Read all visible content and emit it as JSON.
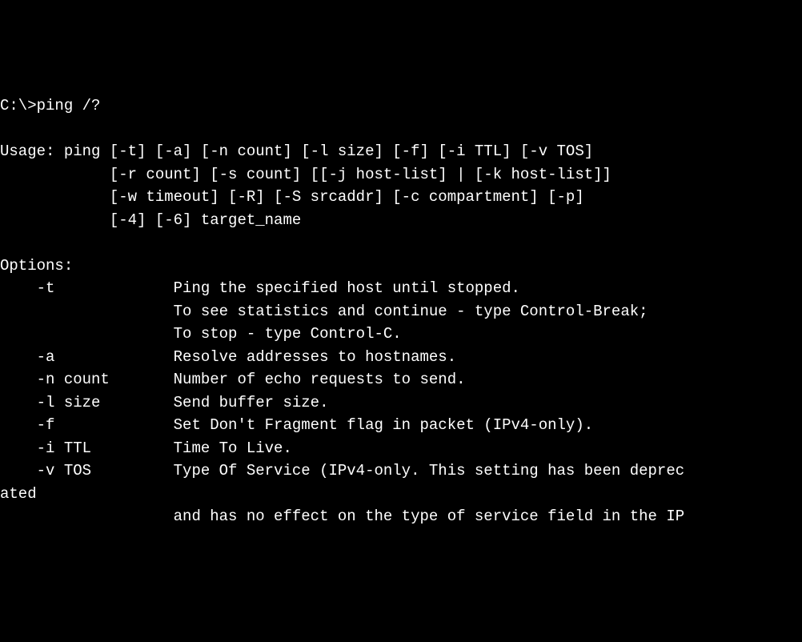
{
  "prompt": "C:\\>ping /?",
  "blank1": "",
  "usage1": "Usage: ping [-t] [-a] [-n count] [-l size] [-f] [-i TTL] [-v TOS]",
  "usage2": "            [-r count] [-s count] [[-j host-list] | [-k host-list]]",
  "usage3": "            [-w timeout] [-R] [-S srcaddr] [-c compartment] [-p]",
  "usage4": "            [-4] [-6] target_name",
  "blank2": "",
  "options_header": "Options:",
  "opt_t_1": "    -t             Ping the specified host until stopped.",
  "opt_t_2": "                   To see statistics and continue - type Control-Break;",
  "opt_t_3": "                   To stop - type Control-C.",
  "opt_a": "    -a             Resolve addresses to hostnames.",
  "opt_n": "    -n count       Number of echo requests to send.",
  "opt_l": "    -l size        Send buffer size.",
  "opt_f": "    -f             Set Don't Fragment flag in packet (IPv4-only).",
  "opt_i": "    -i TTL         Time To Live.",
  "opt_v_1": "    -v TOS         Type Of Service (IPv4-only. This setting has been deprec",
  "opt_v_2": "ated",
  "opt_v_3": "                   and has no effect on the type of service field in the IP"
}
